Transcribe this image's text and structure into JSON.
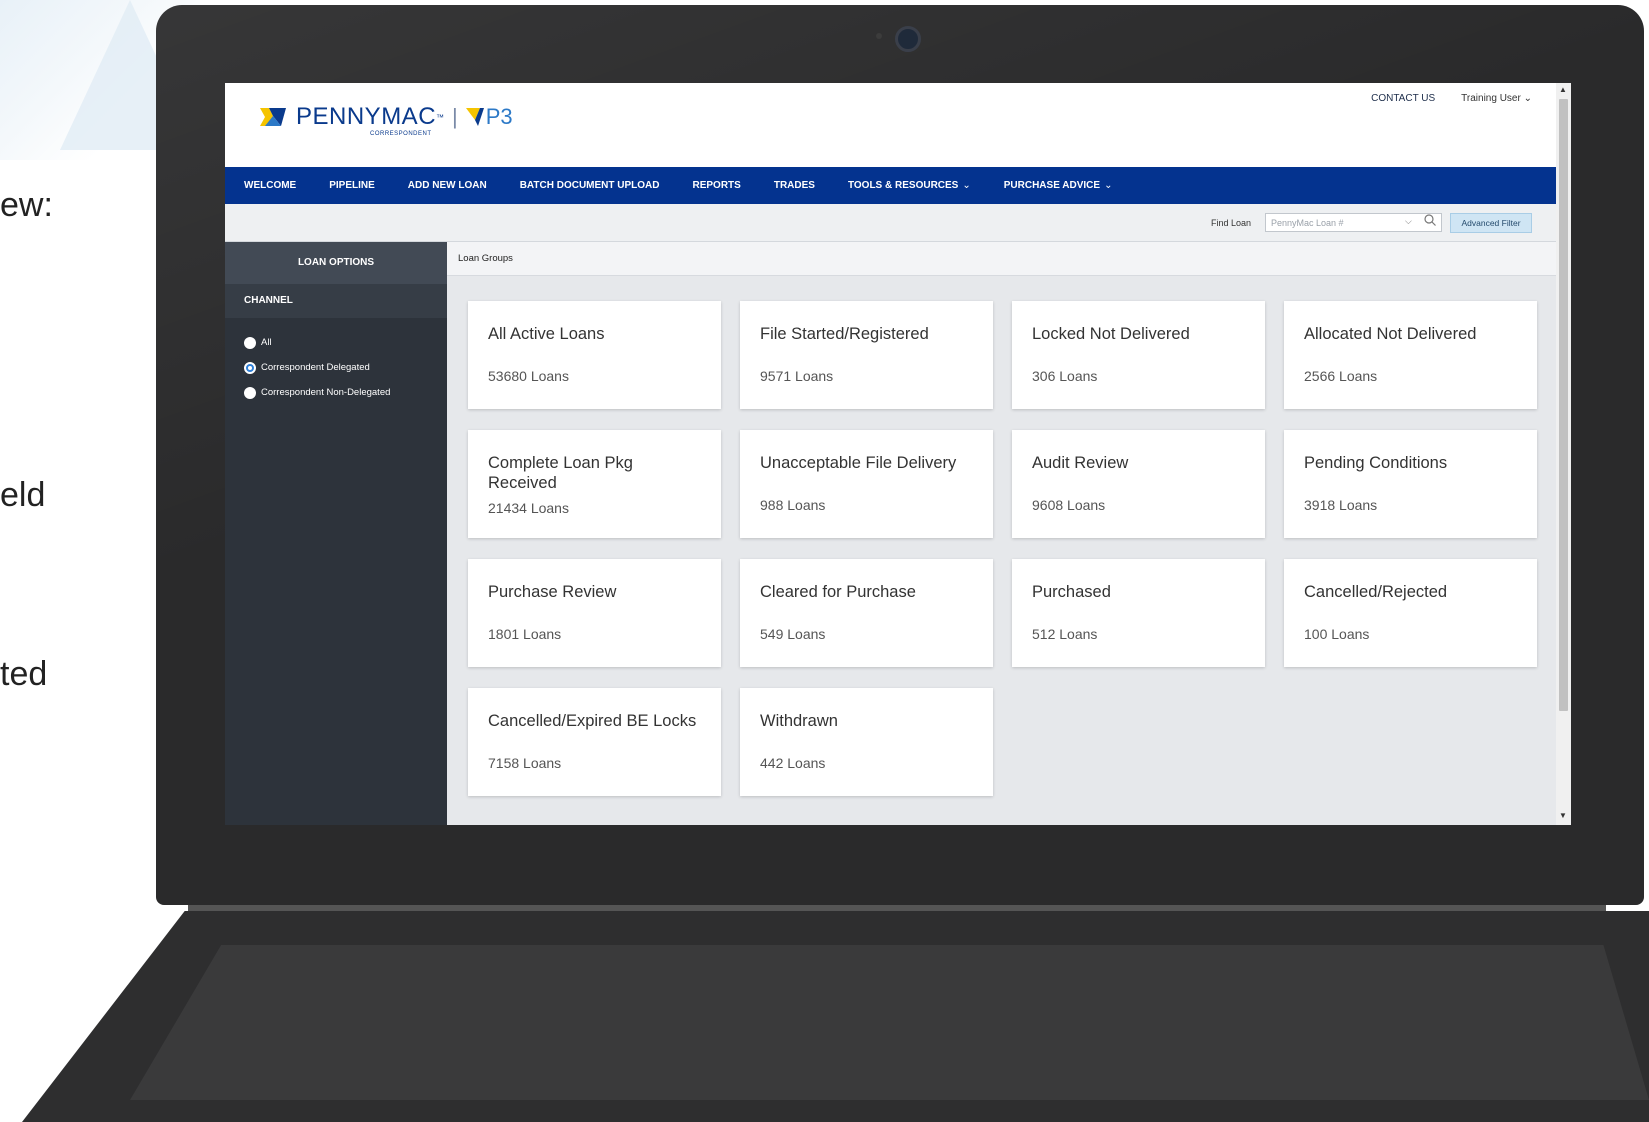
{
  "side_text": [
    "ew:",
    "eld",
    "ted"
  ],
  "header": {
    "logo_text": "PENNYMAC",
    "logo_tm": "™",
    "logo_sub": "CORRESPONDENT",
    "logo_sep": "|",
    "logo_p3": "P3",
    "contact_us": "CONTACT US",
    "user": "Training User",
    "user_chevron": "⌄"
  },
  "nav": {
    "items": [
      {
        "label": "WELCOME"
      },
      {
        "label": "PIPELINE"
      },
      {
        "label": "ADD NEW LOAN"
      },
      {
        "label": "BATCH DOCUMENT UPLOAD"
      },
      {
        "label": "REPORTS"
      },
      {
        "label": "TRADES"
      },
      {
        "label": "TOOLS & RESOURCES",
        "chevron": "⌄"
      },
      {
        "label": "PURCHASE ADVICE",
        "chevron": "⌄"
      }
    ]
  },
  "find": {
    "label": "Find Loan",
    "placeholder": "PennyMac Loan #",
    "advanced_filter": "Advanced Filter"
  },
  "sidebar": {
    "loan_options": "LOAN OPTIONS",
    "channel": "CHANNEL",
    "radios": [
      {
        "label": "All",
        "checked": false
      },
      {
        "label": "Correspondent Delegated",
        "checked": true
      },
      {
        "label": "Correspondent Non-Delegated",
        "checked": false
      }
    ]
  },
  "breadcrumb": "Loan Groups",
  "cards": [
    {
      "title": "All Active Loans",
      "count": "53680 Loans"
    },
    {
      "title": "File Started/Registered",
      "count": "9571 Loans"
    },
    {
      "title": "Locked Not Delivered",
      "count": "306 Loans"
    },
    {
      "title": "Allocated Not Delivered",
      "count": "2566 Loans"
    },
    {
      "title": "Complete Loan Pkg Received",
      "count": "21434 Loans"
    },
    {
      "title": "Unacceptable File Delivery",
      "count": "988 Loans"
    },
    {
      "title": "Audit Review",
      "count": "9608 Loans"
    },
    {
      "title": "Pending Conditions",
      "count": "3918 Loans"
    },
    {
      "title": "Purchase Review",
      "count": "1801 Loans"
    },
    {
      "title": "Cleared for Purchase",
      "count": "549 Loans"
    },
    {
      "title": "Purchased",
      "count": "512 Loans"
    },
    {
      "title": "Cancelled/Rejected",
      "count": "100 Loans"
    },
    {
      "title": "Cancelled/Expired BE Locks",
      "count": "7158 Loans"
    },
    {
      "title": "Withdrawn",
      "count": "442 Loans"
    }
  ],
  "colors": {
    "nav_bg": "#04338f",
    "sidebar_bg": "#2d333b",
    "accent": "#2f80d8",
    "logo_blue": "#0a3a8c",
    "logo_yellow": "#f5c400"
  }
}
